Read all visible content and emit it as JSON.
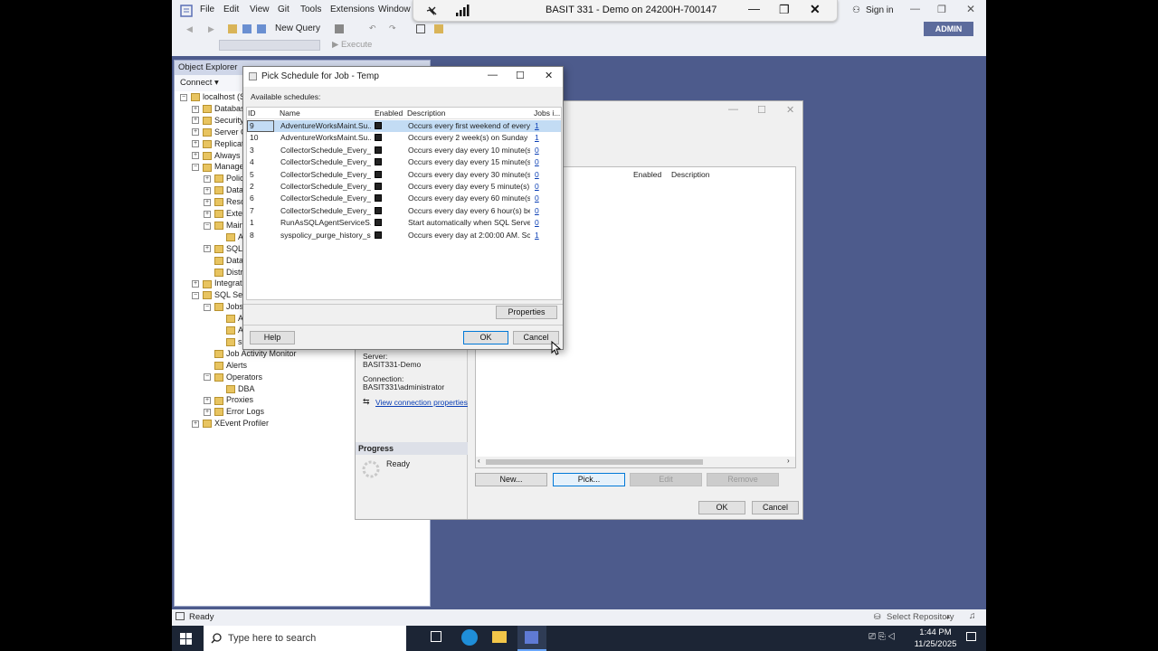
{
  "ssms": {
    "menu": [
      "File",
      "Edit",
      "View",
      "Git",
      "Tools",
      "Extensions",
      "Window"
    ],
    "signin": "Sign in",
    "admin": "ADMIN",
    "new_query": "New Query",
    "execute": "Execute"
  },
  "rdp": {
    "title": "BASIT 331 - Demo on 24200H-700147"
  },
  "object_explorer": {
    "title": "Object Explorer",
    "connect": "Connect ▾",
    "tree": [
      {
        "label": "localhost (S",
        "indent": 0,
        "exp": "−"
      },
      {
        "label": "Databas",
        "indent": 1,
        "exp": "+"
      },
      {
        "label": "Security",
        "indent": 1,
        "exp": "+"
      },
      {
        "label": "Server O",
        "indent": 1,
        "exp": "+"
      },
      {
        "label": "Replicat",
        "indent": 1,
        "exp": "+"
      },
      {
        "label": "Always",
        "indent": 1,
        "exp": "+"
      },
      {
        "label": "Manage",
        "indent": 1,
        "exp": "−"
      },
      {
        "label": "Polic",
        "indent": 2,
        "exp": "+"
      },
      {
        "label": "Data",
        "indent": 2,
        "exp": "+"
      },
      {
        "label": "Reso",
        "indent": 2,
        "exp": "+"
      },
      {
        "label": "Exte",
        "indent": 2,
        "exp": "+"
      },
      {
        "label": "Main",
        "indent": 2,
        "exp": "−"
      },
      {
        "label": "A",
        "indent": 3,
        "exp": ""
      },
      {
        "label": "SQL",
        "indent": 2,
        "exp": "+"
      },
      {
        "label": "Data",
        "indent": 2,
        "exp": ""
      },
      {
        "label": "Distr",
        "indent": 2,
        "exp": ""
      },
      {
        "label": "Integrat",
        "indent": 1,
        "exp": "+"
      },
      {
        "label": "SQL Serv",
        "indent": 1,
        "exp": "−"
      },
      {
        "label": "Jobs",
        "indent": 2,
        "exp": "−"
      },
      {
        "label": "A",
        "indent": 3,
        "exp": ""
      },
      {
        "label": "A",
        "indent": 3,
        "exp": ""
      },
      {
        "label": "s",
        "indent": 3,
        "exp": ""
      },
      {
        "label": "Job Activity Monitor",
        "indent": 2,
        "exp": ""
      },
      {
        "label": "Alerts",
        "indent": 2,
        "exp": ""
      },
      {
        "label": "Operators",
        "indent": 2,
        "exp": "−"
      },
      {
        "label": "DBA",
        "indent": 3,
        "exp": ""
      },
      {
        "label": "Proxies",
        "indent": 2,
        "exp": "+"
      },
      {
        "label": "Error Logs",
        "indent": 2,
        "exp": "+"
      },
      {
        "label": "XEvent Profiler",
        "indent": 1,
        "exp": "+"
      }
    ]
  },
  "bg_dialog": {
    "col_enabled": "Enabled",
    "col_description": "Description",
    "server_label": "Server:",
    "server_value": "BASIT331-Demo",
    "connection_label": "Connection:",
    "connection_value": "BASIT331\\administrator",
    "view_conn": "View connection properties",
    "progress": "Progress",
    "ready": "Ready",
    "btn_new": "New...",
    "btn_pick": "Pick...",
    "btn_edit": "Edit",
    "btn_remove": "Remove",
    "btn_ok": "OK",
    "btn_cancel": "Cancel"
  },
  "dialog": {
    "title": "Pick Schedule for Job - Temp",
    "available": "Available schedules:",
    "headers": {
      "id": "ID",
      "name": "Name",
      "enabled": "Enabled",
      "description": "Description",
      "jobs": "Jobs i..."
    },
    "rows": [
      {
        "id": "9",
        "name": "AdventureWorksMaint.Su...",
        "desc": "Occurs every first weekend of every ...",
        "jobs": "1"
      },
      {
        "id": "10",
        "name": "AdventureWorksMaint.Su...",
        "desc": "Occurs every 2 week(s) on Sunday a...",
        "jobs": "1"
      },
      {
        "id": "3",
        "name": "CollectorSchedule_Every_...",
        "desc": "Occurs every day every 10 minute(s) ...",
        "jobs": "0"
      },
      {
        "id": "4",
        "name": "CollectorSchedule_Every_...",
        "desc": "Occurs every day every 15 minute(s) ...",
        "jobs": "0"
      },
      {
        "id": "5",
        "name": "CollectorSchedule_Every_...",
        "desc": "Occurs every day every 30 minute(s) ...",
        "jobs": "0"
      },
      {
        "id": "2",
        "name": "CollectorSchedule_Every_...",
        "desc": "Occurs every day every 5 minute(s) b...",
        "jobs": "0"
      },
      {
        "id": "6",
        "name": "CollectorSchedule_Every_...",
        "desc": "Occurs every day every 60 minute(s) ...",
        "jobs": "0"
      },
      {
        "id": "7",
        "name": "CollectorSchedule_Every_...",
        "desc": "Occurs every day every 6 hour(s) bet...",
        "jobs": "0"
      },
      {
        "id": "1",
        "name": "RunAsSQLAgentServiceS...",
        "desc": "Start automatically when SQL Server...",
        "jobs": "0"
      },
      {
        "id": "8",
        "name": "syspolicy_purge_history_s...",
        "desc": "Occurs every day at 2:00:00 AM. Sc...",
        "jobs": "1"
      }
    ],
    "btn_properties": "Properties",
    "btn_help": "Help",
    "btn_ok": "OK",
    "btn_cancel": "Cancel"
  },
  "statusbar": {
    "ready": "Ready",
    "repo": "Select Repository"
  },
  "taskbar": {
    "search": "Type here to search",
    "time": "1:44 PM",
    "date": "11/25/2025"
  }
}
